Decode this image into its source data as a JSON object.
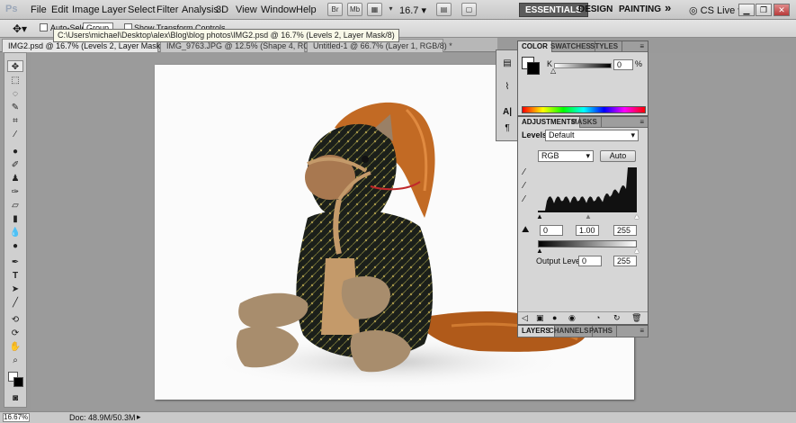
{
  "app": {
    "logo": "Ps"
  },
  "menu": [
    "File",
    "Edit",
    "Image",
    "Layer",
    "Select",
    "Filter",
    "Analysis",
    "3D",
    "View",
    "Window",
    "Help"
  ],
  "app_bar": {
    "zoom": "16.7",
    "workspaces": [
      "ESSENTIALS",
      "DESIGN",
      "PAINTING"
    ],
    "more": "»",
    "cs_live": "CS Live"
  },
  "options_bar": {
    "auto_select": "Auto-Select:",
    "auto_select_value": "Group",
    "show_transform": "Show Transform Controls"
  },
  "tooltip": "C:\\Users\\michael\\Desktop\\alex\\Blog\\blog photos\\IMG2.psd @ 16.7% (Levels 2, Layer Mask/8)",
  "tabs": [
    {
      "label": "IMG2.psd @ 16.7% (Levels 2, Layer Mask/8) *",
      "active": true
    },
    {
      "label": "IMG_9763.JPG @ 12.5% (Shape 4, RGB/8) *",
      "active": false
    },
    {
      "label": "Untitled-1 @ 66.7% (Layer 1, RGB/8) *",
      "active": false
    }
  ],
  "status": {
    "zoom": "16.67%",
    "doc": "Doc: 48.9M/50.3M"
  },
  "color_panel": {
    "tabs": [
      "COLOR",
      "SWATCHES",
      "STYLES"
    ],
    "channel": "K",
    "value": "0",
    "unit": "%"
  },
  "adjustments_panel": {
    "tabs": [
      "ADJUSTMENTS",
      "MASKS"
    ],
    "label": "Levels",
    "preset": "Default",
    "channel": "RGB",
    "auto": "Auto",
    "input_black": "0",
    "input_gamma": "1.00",
    "input_white": "255",
    "output_label": "Output Levels:",
    "output_black": "0",
    "output_white": "255"
  },
  "layers_panel": {
    "tabs": [
      "LAYERS",
      "CHANNELS",
      "PATHS"
    ]
  },
  "colors": {
    "panel_bg": "#d6d6d6",
    "workspace_active": "#5b5b5b",
    "ui_bg": "#9b9b9b"
  }
}
